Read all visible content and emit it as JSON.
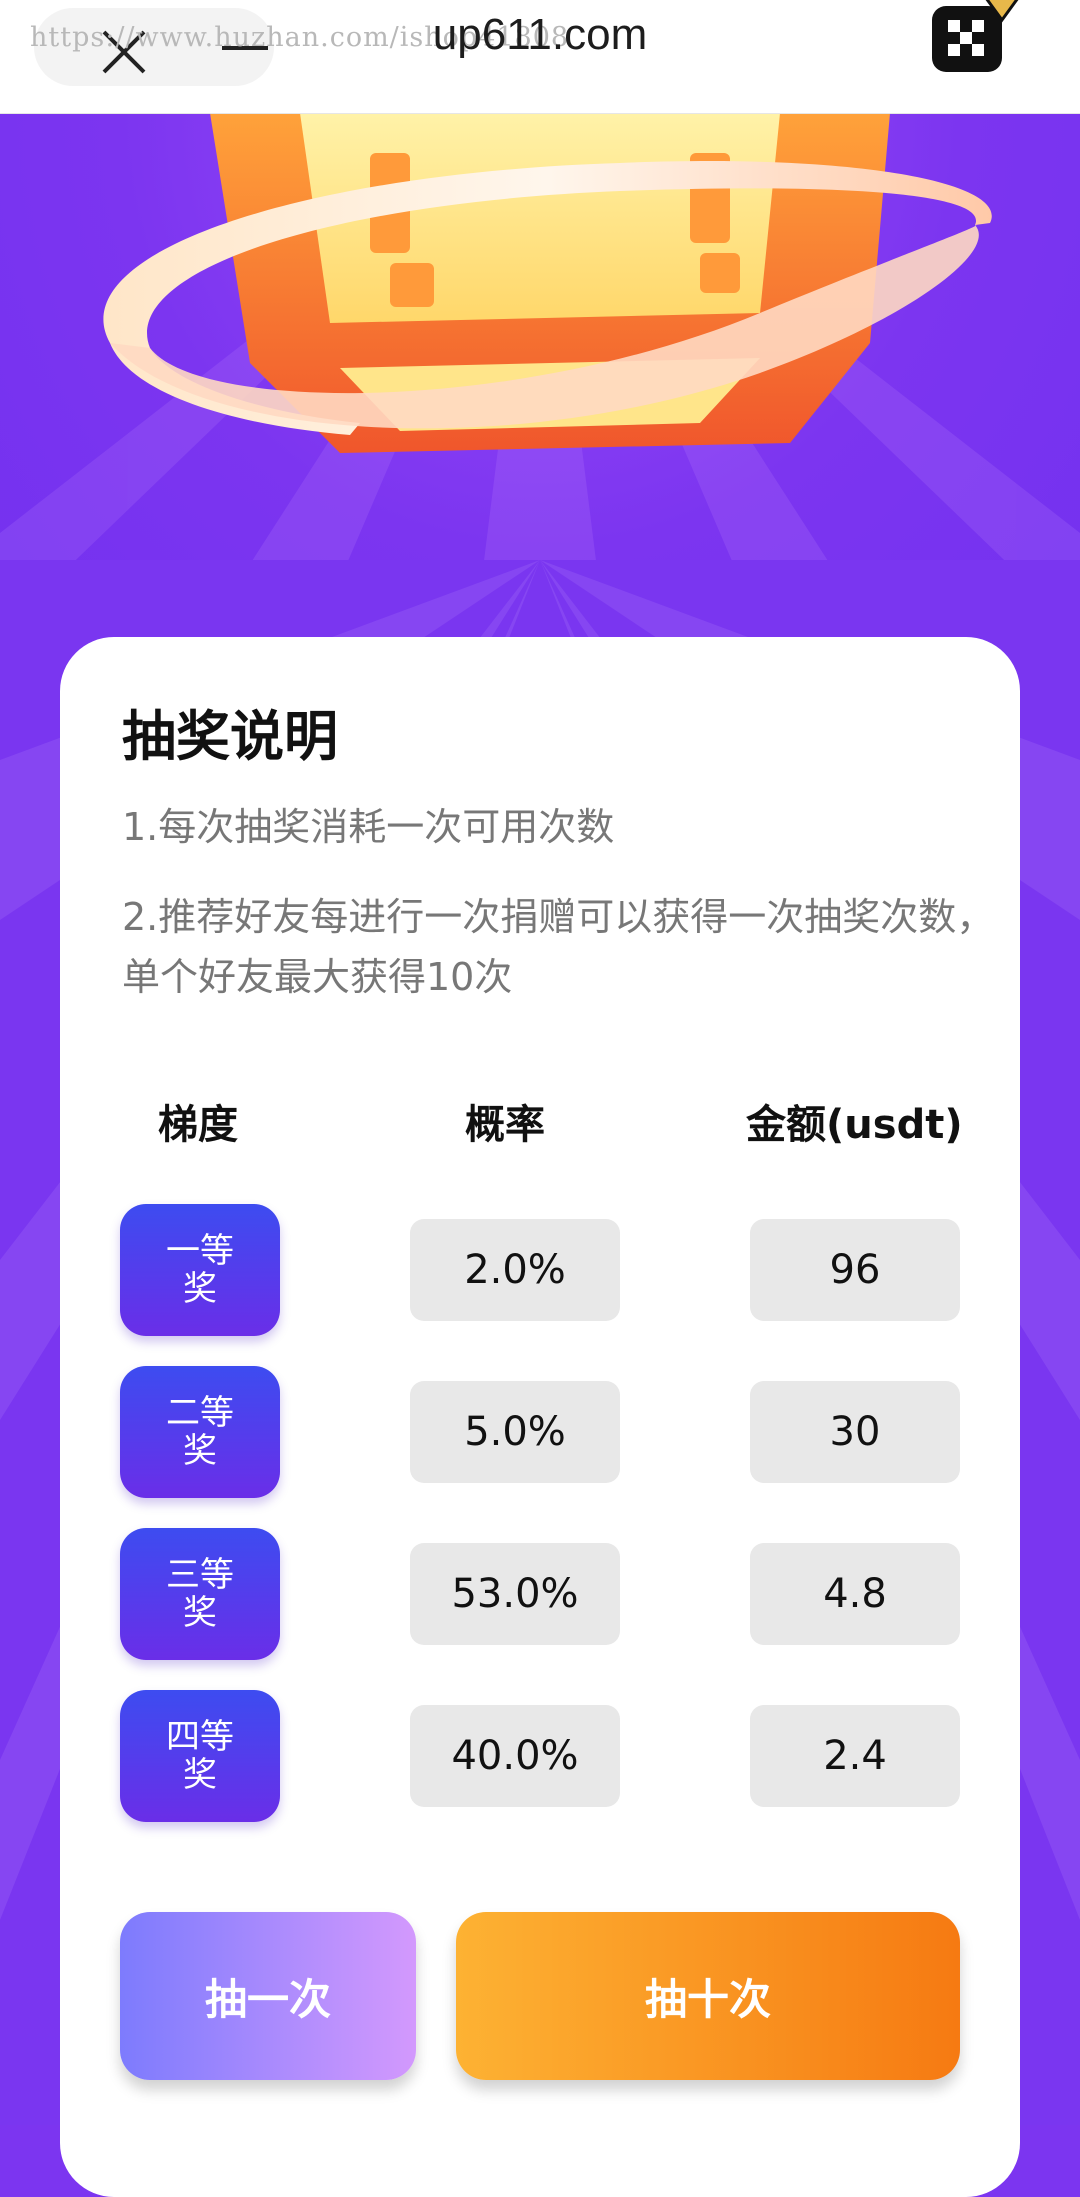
{
  "browser": {
    "title": "up611.com",
    "watermark": "https://www.huzhan.com/ishop41808",
    "close_icon": "close-icon",
    "menu_icon": "menu-icon",
    "logo_icon": "app-logo-icon"
  },
  "lottery": {
    "title": "抽奖说明",
    "rules": [
      "1.每次抽奖消耗一次可用次数",
      "2.推荐好友每进行一次捐赠可以获得一次抽奖次数，单个好友最大获得10次"
    ],
    "columns": [
      "梯度",
      "概率",
      "金额(usdt)"
    ],
    "tiers": [
      {
        "name": "一等奖",
        "probability": "2.0%",
        "amount": "96"
      },
      {
        "name": "二等奖",
        "probability": "5.0%",
        "amount": "30"
      },
      {
        "name": "三等奖",
        "probability": "53.0%",
        "amount": "4.8"
      },
      {
        "name": "四等奖",
        "probability": "40.0%",
        "amount": "2.4"
      }
    ],
    "draw_once_label": "抽一次",
    "draw_ten_label": "抽十次"
  },
  "colors": {
    "background": "#7c35f0",
    "tier_badge": "#4a3fee",
    "draw_once": "#a98cfd",
    "draw_ten": "#f89a22"
  }
}
